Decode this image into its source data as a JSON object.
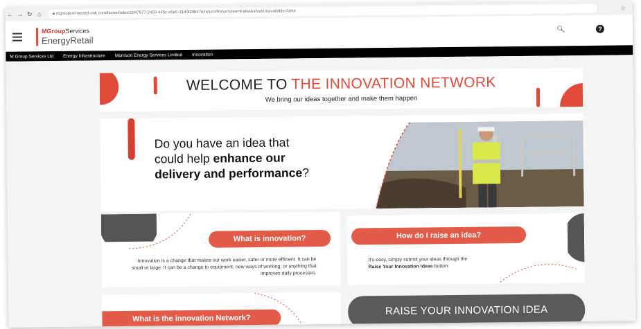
{
  "browser": {
    "url": "mgroupconnected.oak.com/home/index/1947977-2459-446c-a5e5-31d0f29b57e/return/ReturnView=False&showUnavailable=false"
  },
  "app": {
    "brand_top": "MGroup",
    "brand_top_suffix": "Services",
    "brand_main": "EnergyRetail"
  },
  "nav": {
    "items": [
      "M Group Services Ltd",
      "Energy Infrastructure",
      "Morrison Energy Services Limited",
      "Innovation"
    ]
  },
  "welcome": {
    "title_prefix": "WELCOME TO ",
    "title_highlight": "THE INNOVATION NETWORK",
    "subtitle": "We bring our ideas together and make them happen"
  },
  "banner": {
    "line1": "Do you have an idea that",
    "line2_prefix": "could help ",
    "line2_bold": "enhance our",
    "line3_bold": "delivery and performance",
    "line3_suffix": "?"
  },
  "cards": {
    "innovation_title": "What is innovation?",
    "innovation_text": "Innovation is a change that makes our work easier, safer or more efficient. It can be small or large. It can be a change to equipment, new ways of working, or anything that improves daily processes.",
    "raise_title": "How do I raise an idea?",
    "raise_text_prefix": "It's easy, simply submit your ideas through the",
    "raise_text_bold": "Raise Your Innovation Ideas",
    "raise_text_suffix": " button.",
    "network_title": "What is the innovation Network?",
    "raise_button": "RAISE YOUR INNOVATION IDEA"
  },
  "colors": {
    "accent": "#e04a3a",
    "dark": "#5a5a5a",
    "nav_bg": "#000000"
  }
}
